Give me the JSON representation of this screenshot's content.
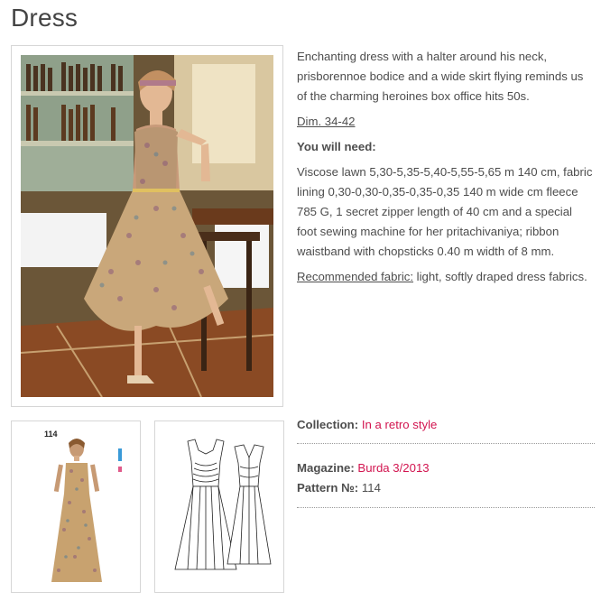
{
  "page": {
    "title": "Dress"
  },
  "gallery": {
    "thumb_number": "114"
  },
  "description": {
    "intro": "Enchanting dress with a halter around his neck, prisborennoe bodice and a wide skirt flying reminds us of the charming heroines box office hits 50s.",
    "dim": "Dim. 34-42",
    "need_heading": "You will need:",
    "requirements": "Viscose lawn 5,30-5,35-5,40-5,55-5,65 m 140 cm, fabric lining 0,30-0,30-0,35-0,35-0,35 140 m wide cm fleece 785 G, 1 secret zipper length of 40 cm and a special foot sewing machine for her pritachivaniya; ribbon waistband with chopsticks 0.40 m width of 8 mm.",
    "recommended_label": "Recommended fabric:",
    "recommended_value": " light, softly draped dress fabrics."
  },
  "meta": {
    "collection_label": "Collection:",
    "collection_value": "In a retro style",
    "magazine_label": "Magazine:",
    "magazine_value": "Burda 3/2013",
    "pattern_label": "Pattern №:",
    "pattern_value": "114"
  },
  "colors": {
    "link": "#d2144f",
    "text": "#4d4d4d"
  },
  "icons": [
    "dress-photo",
    "dress-model-thumbnail",
    "technical-drawing"
  ]
}
